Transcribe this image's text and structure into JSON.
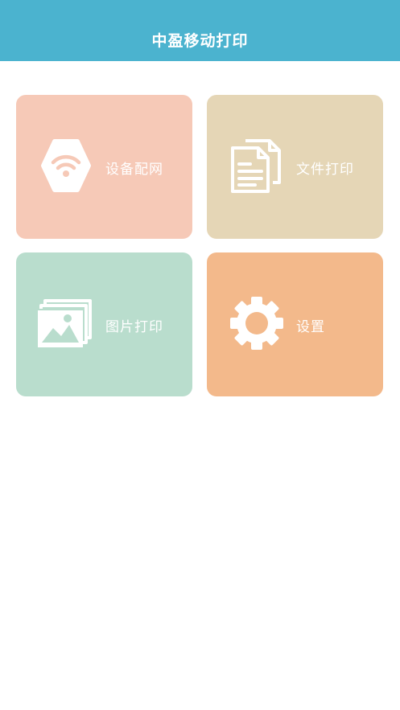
{
  "header": {
    "title": "中盈移动打印",
    "color": "#4bb3cf"
  },
  "tiles": [
    {
      "label": "设备配网",
      "icon": "wifi-hexagon-icon",
      "color": "#f6c9b7"
    },
    {
      "label": "文件打印",
      "icon": "documents-icon",
      "color": "#e5d6b6"
    },
    {
      "label": "图片打印",
      "icon": "images-icon",
      "color": "#b9ddcd"
    },
    {
      "label": "设置",
      "icon": "gear-icon",
      "color": "#f3b98b"
    }
  ]
}
